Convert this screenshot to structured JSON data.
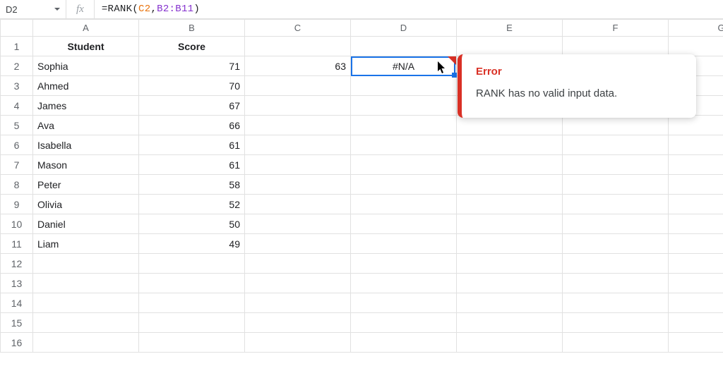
{
  "name_box": "D2",
  "fx_label": "fx",
  "formula": {
    "eq": "=",
    "func": "RANK",
    "lparen": "(",
    "arg1": "C2",
    "comma": ",",
    "arg2": "B2:B11",
    "rparen": ")"
  },
  "columns": [
    "A",
    "B",
    "C",
    "D",
    "E",
    "F",
    "G"
  ],
  "row_count": 16,
  "headers": {
    "A": "Student",
    "B": "Score"
  },
  "rows": [
    {
      "student": "Sophia",
      "score": "71"
    },
    {
      "student": "Ahmed",
      "score": "70"
    },
    {
      "student": "James",
      "score": "67"
    },
    {
      "student": "Ava",
      "score": "66"
    },
    {
      "student": "Isabella",
      "score": "61"
    },
    {
      "student": "Mason",
      "score": "61"
    },
    {
      "student": "Peter",
      "score": "58"
    },
    {
      "student": "Olivia",
      "score": "52"
    },
    {
      "student": "Daniel",
      "score": "50"
    },
    {
      "student": "Liam",
      "score": "49"
    }
  ],
  "c2_value": "63",
  "d2_value": "#N/A",
  "tooltip": {
    "title": "Error",
    "body": "RANK has no valid input data."
  }
}
